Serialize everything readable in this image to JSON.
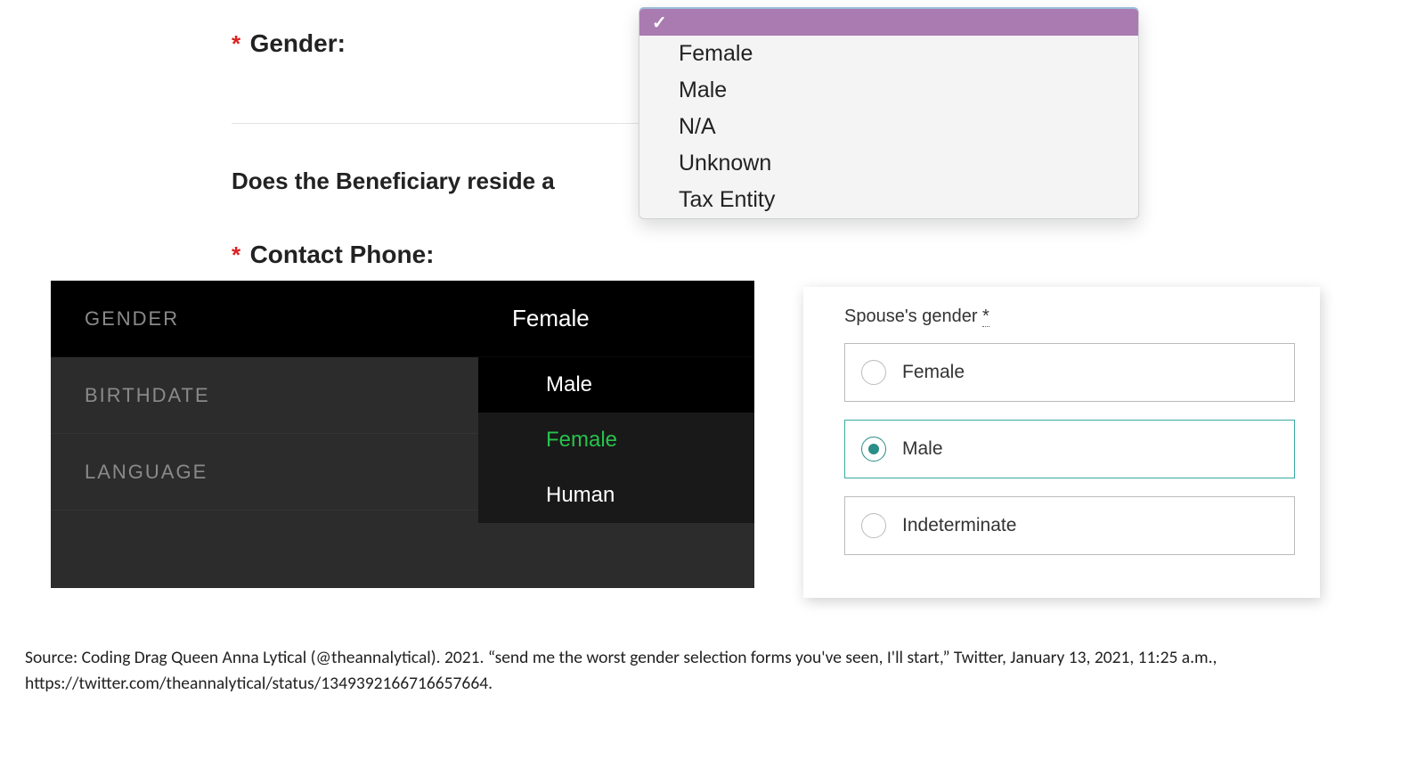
{
  "panelA": {
    "required_mark": "*",
    "gender_label": "Gender:",
    "hr": true,
    "beneficiary_question_visible": "Does the Beneficiary reside a",
    "contact_label": "Contact Phone:",
    "dropdown": {
      "selected_glyph": "✓",
      "options": [
        "Female",
        "Male",
        "N/A",
        "Unknown",
        "Tax Entity"
      ]
    }
  },
  "panelB": {
    "rows": [
      {
        "key": "GENDER",
        "value": "Female",
        "active": true
      },
      {
        "key": "BIRTHDATE",
        "value": ""
      },
      {
        "key": "LANGUAGE",
        "value": ""
      }
    ],
    "submenu": [
      "Male",
      "Female",
      "Human"
    ],
    "submenu_hover_index": 0,
    "submenu_highlight_index": 1
  },
  "panelC": {
    "title_text": "Spouse's gender",
    "title_asterisk": "*",
    "options": [
      "Female",
      "Male",
      "Indeterminate"
    ],
    "selected_index": 1
  },
  "caption": {
    "text": "Source: Coding Drag Queen Anna Lytical (@theannalytical). 2021. “send me the worst gender selection forms you've seen, I'll start,” Twitter, January 13, 2021, 11:25 a.m., https://twitter.com/theannalytical/status/1349392166716657664."
  }
}
